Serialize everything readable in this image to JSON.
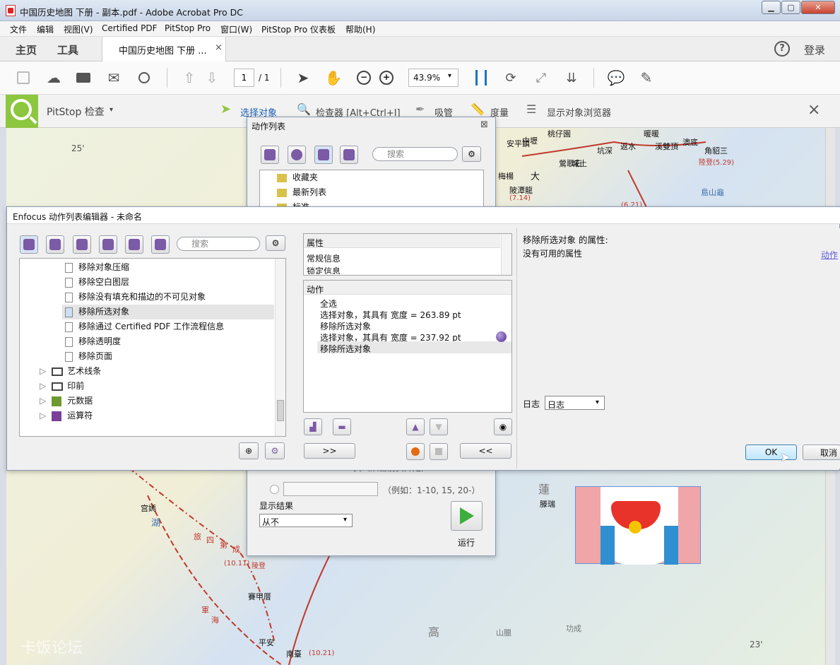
{
  "window": {
    "title": "中国历史地图 下册 - 副本.pdf - Adobe Acrobat Pro DC"
  },
  "menu": [
    "文件",
    "编辑",
    "视图(V)",
    "Certified PDF",
    "PitStop Pro",
    "窗口(W)",
    "PitStop Pro 仪表板",
    "帮助(H)"
  ],
  "tabs": {
    "home": "主页",
    "tools": "工具",
    "doc": "中国历史地图 下册 ...",
    "close": "×",
    "help": "?",
    "login": "登录"
  },
  "toolbar": {
    "page_current": "1",
    "page_total": "/ 1",
    "zoom": "43.9%"
  },
  "pitstop": {
    "title": "PitStop 检查",
    "select": "选择对象",
    "inspector": "检查器 [Alt+Ctrl+I]",
    "eyedropper": "吸管",
    "measure": "度量",
    "browser": "显示对象浏览器",
    "close": "×"
  },
  "actionlist": {
    "title": "动作列表",
    "close": "⊠",
    "search": "搜索",
    "items": [
      "收藏夹",
      "最新列表",
      "标准"
    ],
    "display_result_label": "显示结果",
    "display_result_value": "从不",
    "run": "运行",
    "page_range_hint": "页（从当前页开始）",
    "example": "（例如：1-10, 15, 20-）"
  },
  "editor": {
    "title": "Enfocus 动作列表编辑器 - 未命名",
    "search": "搜索",
    "tree": [
      {
        "label": "移除对象压缩"
      },
      {
        "label": "移除空白图层"
      },
      {
        "label": "移除没有填充和描边的不可见对象"
      },
      {
        "label": "移除所选对象"
      },
      {
        "label": "移除通过 Certified PDF 工作流程信息"
      },
      {
        "label": "移除透明度"
      },
      {
        "label": "移除页面"
      }
    ],
    "groups": [
      "艺术线条",
      "印前",
      "元数据",
      "运算符"
    ],
    "prop_panel": {
      "header": "属性",
      "rows": [
        "常规信息",
        "锁定信息"
      ]
    },
    "action_panel": {
      "header": "动作",
      "rows": [
        "全选",
        "选择对象，其具有 宽度 = 263.89 pt",
        "移除所选对象",
        "选择对象，其具有 宽度 = 237.92 pt",
        "移除所选对象"
      ]
    },
    "forward": ">>",
    "back": "<<",
    "right_title": "移除所选对象 的属性:",
    "no_props": "没有可用的属性",
    "action_link": "动作",
    "log_label": "日志",
    "log_value": "日志",
    "ok": "OK",
    "cancel": "取消"
  },
  "map": {
    "labels": [
      "宫嫣",
      "湖",
      "旅",
      "四",
      "第",
      "成",
      "(10.11)",
      "陵登",
      "軍",
      "海",
      "賽甲厝",
      "平安",
      "南臺",
      "(10.21)",
      "功成",
      "山臘",
      "高",
      "蓮",
      "滕瑞",
      "暖暖",
      "溪雙頂",
      "澳底",
      "角貂三",
      "陸登(5.29)",
      "島山龜",
      "大",
      "城土",
      "坑深",
      "返水",
      "安平鎮",
      "中壢",
      "桃仔園",
      "鶯歌石",
      "梅楊",
      "陂潭龍",
      "(7.14)",
      "(6.21)",
      "25'",
      "23'"
    ],
    "watermark": "卡饭论坛"
  }
}
